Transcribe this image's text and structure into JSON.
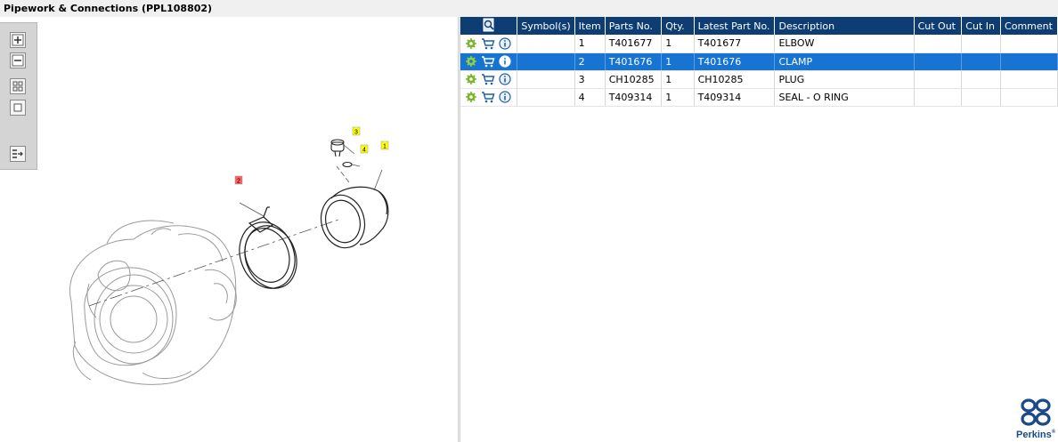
{
  "window": {
    "title": "Pipework & Connections (PPL108802)"
  },
  "table": {
    "headers": [
      "",
      "Symbol(s)",
      "Item",
      "Parts No.",
      "Qty.",
      "Latest Part No.",
      "Description",
      "Cut Out",
      "Cut In",
      "Comment"
    ],
    "rows": [
      {
        "symbols": "",
        "item": "1",
        "part_no": "T401677",
        "qty": "1",
        "latest_part_no": "T401677",
        "description": "ELBOW",
        "cut_out": "",
        "cut_in": "",
        "comment": "",
        "selected": false
      },
      {
        "symbols": "",
        "item": "2",
        "part_no": "T401676",
        "qty": "1",
        "latest_part_no": "T401676",
        "description": "CLAMP",
        "cut_out": "",
        "cut_in": "",
        "comment": "",
        "selected": true
      },
      {
        "symbols": "",
        "item": "3",
        "part_no": "CH10285",
        "qty": "1",
        "latest_part_no": "CH10285",
        "description": "PLUG",
        "cut_out": "",
        "cut_in": "",
        "comment": "",
        "selected": false
      },
      {
        "symbols": "",
        "item": "4",
        "part_no": "T409314",
        "qty": "1",
        "latest_part_no": "T409314",
        "description": "SEAL - O RING",
        "cut_out": "",
        "cut_in": "",
        "comment": "",
        "selected": false
      }
    ]
  },
  "drawing": {
    "callouts": [
      {
        "label": "1",
        "color": "#ffff00"
      },
      {
        "label": "2",
        "color": "#ff6060"
      },
      {
        "label": "3",
        "color": "#ffff00"
      },
      {
        "label": "4",
        "color": "#ffff00"
      }
    ]
  },
  "toolbar": {
    "icons": [
      "zoom-in-icon",
      "zoom-out-icon",
      "fit-all-icon",
      "fit-window-icon",
      "list-arrow-icon"
    ]
  },
  "logo": {
    "text": "Perkins",
    "mark": "®"
  },
  "colors": {
    "header": "#0e3d73",
    "selected": "#1874d2",
    "callout_yellow": "#ffff00",
    "callout_red": "#ff6060"
  }
}
